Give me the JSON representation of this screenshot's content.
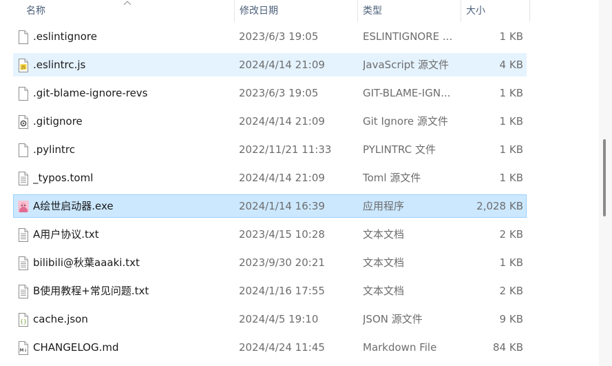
{
  "columns": {
    "name": "名称",
    "date": "修改日期",
    "type": "类型",
    "size": "大小"
  },
  "sort": {
    "column": "name",
    "direction": "ascending",
    "icon": "sort-up-chevron-icon"
  },
  "files": [
    {
      "name": ".eslintignore",
      "date": "2023/6/3 19:05",
      "type": "ESLINTIGNORE ...",
      "size": "1 KB",
      "icon": "blank-file-icon",
      "state": "normal"
    },
    {
      "name": ".eslintrc.js",
      "date": "2024/4/14 21:09",
      "type": "JavaScript 源文件",
      "size": "4 KB",
      "icon": "js-file-icon",
      "state": "hover"
    },
    {
      "name": ".git-blame-ignore-revs",
      "date": "2023/6/3 19:05",
      "type": "GIT-BLAME-IGN...",
      "size": "1 KB",
      "icon": "blank-file-icon",
      "state": "normal"
    },
    {
      "name": ".gitignore",
      "date": "2024/4/14 21:09",
      "type": "Git Ignore 源文件",
      "size": "1 KB",
      "icon": "config-file-icon",
      "state": "normal"
    },
    {
      "name": ".pylintrc",
      "date": "2022/11/21 11:33",
      "type": "PYLINTRC 文件",
      "size": "1 KB",
      "icon": "blank-file-icon",
      "state": "normal"
    },
    {
      "name": "_typos.toml",
      "date": "2024/4/14 21:09",
      "type": "Toml 源文件",
      "size": "1 KB",
      "icon": "text-file-icon",
      "state": "normal"
    },
    {
      "name": "A绘世启动器.exe",
      "date": "2024/1/14 16:39",
      "type": "应用程序",
      "size": "2,028 KB",
      "icon": "app-avatar-icon",
      "state": "selected"
    },
    {
      "name": "A用户协议.txt",
      "date": "2023/4/15 10:28",
      "type": "文本文档",
      "size": "2 KB",
      "icon": "text-file-icon",
      "state": "normal"
    },
    {
      "name": "bilibili@秋葉aaaki.txt",
      "date": "2023/9/30 20:21",
      "type": "文本文档",
      "size": "1 KB",
      "icon": "text-file-icon",
      "state": "normal"
    },
    {
      "name": "B使用教程+常见问题.txt",
      "date": "2024/1/16 17:55",
      "type": "文本文档",
      "size": "2 KB",
      "icon": "text-file-icon",
      "state": "normal"
    },
    {
      "name": "cache.json",
      "date": "2024/4/5 19:10",
      "type": "JSON 源文件",
      "size": "9 KB",
      "icon": "json-file-icon",
      "state": "normal"
    },
    {
      "name": "CHANGELOG.md",
      "date": "2024/4/24 11:45",
      "type": "Markdown File",
      "size": "84 KB",
      "icon": "markdown-file-icon",
      "state": "normal"
    }
  ],
  "colors": {
    "hover_bg": "#e5f3ff",
    "selected_bg": "#cce8ff",
    "selected_border": "#99d1ff",
    "header_text": "#4c607a",
    "secondary_text": "#6d6d6d",
    "primary_text": "#1a1a1a"
  }
}
